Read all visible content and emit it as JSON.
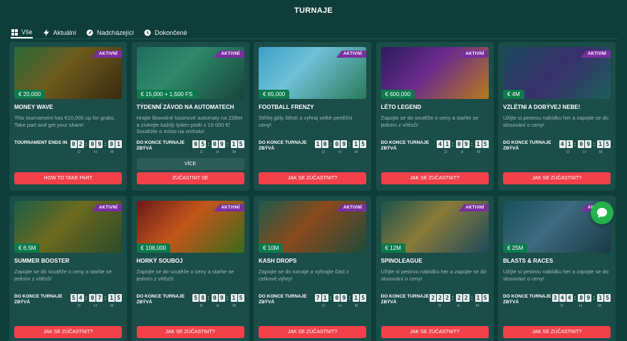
{
  "header": {
    "title": "TURNAJE"
  },
  "tabs": [
    {
      "label": "Vše",
      "icon": "grid-icon",
      "active": true
    },
    {
      "label": "Aktuální",
      "icon": "lightning-icon",
      "active": false
    },
    {
      "label": "Nadcházející",
      "icon": "rocket-icon",
      "active": false
    },
    {
      "label": "Dokončené",
      "icon": "clock-icon",
      "active": false
    }
  ],
  "badge_label": "AKTIVNÍ",
  "units": {
    "d": "D",
    "h": "H",
    "m": "M"
  },
  "colors": {
    "background": "#0f3d3a",
    "card": "#1b4d49",
    "accent_red": "#f0414a",
    "badge": "#7a2ea0",
    "prize": "#0c7a4c",
    "chat": "#24b24a"
  },
  "cards": [
    {
      "title": "MONEY WAVE",
      "prize": "€ 20,000",
      "desc": "This tournament has €10,000 up for grabs. Take part and get your share!",
      "timer_label": "TOURNAMENT ENDS IN",
      "days": "02",
      "hours": "09",
      "minutes": "01",
      "button": "HOW TO TAKE PART",
      "theme": "money"
    },
    {
      "title": "TÝDENNÍ ZÁVOD NA AUTOMATECH",
      "prize": "€ 15,000 + 1,500 FS",
      "desc": "Hrajte libovolné kasinové automaty na 22Bet a získejte každý týden pódií z 15 000 €! Soutěžte o místo na vrcholu!",
      "timer_label": "DO KONCE TURNAJE ZBÝVÁ",
      "days": "05",
      "hours": "09",
      "minutes": "15",
      "more_button": "VÍCE",
      "button": "ZÚČASTNIT SE",
      "theme": "race"
    },
    {
      "title": "FOOTBALL FRENZY",
      "prize": "€ 65,000",
      "desc": "Střílej góly štěstí a vyhraj velké peněžní ceny!",
      "timer_label": "DO KONCE TURNAJE ZBÝVÁ",
      "days": "10",
      "hours": "09",
      "minutes": "15",
      "button": "JAK SE ZÚČASTNIT?",
      "theme": "football"
    },
    {
      "title": "LÉTO LEGEND",
      "prize": "€ 600,000",
      "desc": "Zapojte se do soutěže o ceny a staňte se jedním z vítězů!",
      "timer_label": "DO KONCE TURNAJE ZBÝVÁ",
      "days": "41",
      "hours": "09",
      "minutes": "15",
      "button": "JAK SE ZÚČASTNIT?",
      "theme": "legend"
    },
    {
      "title": "VZLÉTNI A DOBÝVEJ NEBE!",
      "prize": "€ 4M",
      "desc": "Užijte si pestrou nabídku her a zapojte se do slosování o ceny!",
      "timer_label": "DO KONCE TURNAJE ZBÝVÁ",
      "days": "41",
      "hours": "09",
      "minutes": "15",
      "button": "JAK SE ZÚČASTNIT?",
      "theme": "sky"
    },
    {
      "title": "SUMMER BOOSTER",
      "prize": "€ 6.5M",
      "desc": "Zapojte se do soutěže o ceny a staňte se jedním z vítězů!",
      "timer_label": "DO KONCE TURNAJE ZBÝVÁ",
      "days": "54",
      "hours": "07",
      "minutes": "15",
      "button": "JAK SE ZÚČASTNIT?",
      "theme": "summer"
    },
    {
      "title": "HORKÝ SOUBOJ",
      "prize": "€ 108,000",
      "desc": "Zapojte se do soutěže o ceny a staňte se jedním z vítězů!",
      "timer_label": "DO KONCE TURNAJE ZBÝVÁ",
      "days": "58",
      "hours": "09",
      "minutes": "15",
      "button": "JAK SE ZÚČASTNIT?",
      "theme": "hot"
    },
    {
      "title": "KASH DROPS",
      "prize": "€ 10M",
      "desc": "Zapojte se do turnaje a vyhrajte část z celkové výhry!",
      "timer_label": "DO KONCE TURNAJE ZBÝVÁ",
      "days": "71",
      "hours": "09",
      "minutes": "15",
      "button": "JAK SE ZÚČASTNIT?",
      "theme": "kash"
    },
    {
      "title": "SPINOLEAGUE",
      "prize": "€ 12M",
      "desc": "Užijte si pestrou nabídku her a zapojte se do slosování o ceny!",
      "timer_label": "DO KONCE TURNAJE ZBÝVÁ",
      "days": "222",
      "hours": "22",
      "minutes": "15",
      "button": "JAK SE ZÚČASTNIT?",
      "theme": "spino"
    },
    {
      "title": "BLASTS & RACES",
      "prize": "€ 25M",
      "desc": "Užijte si pestrou nabídku her a zapojte se do slosování o ceny!",
      "timer_label": "DO KONCE TURNAJE ZBÝVÁ",
      "days": "344",
      "hours": "09",
      "minutes": "15",
      "button": "JAK SE ZÚČASTNIT?",
      "theme": "rhino"
    }
  ],
  "chat": {
    "icon": "chat-icon"
  }
}
